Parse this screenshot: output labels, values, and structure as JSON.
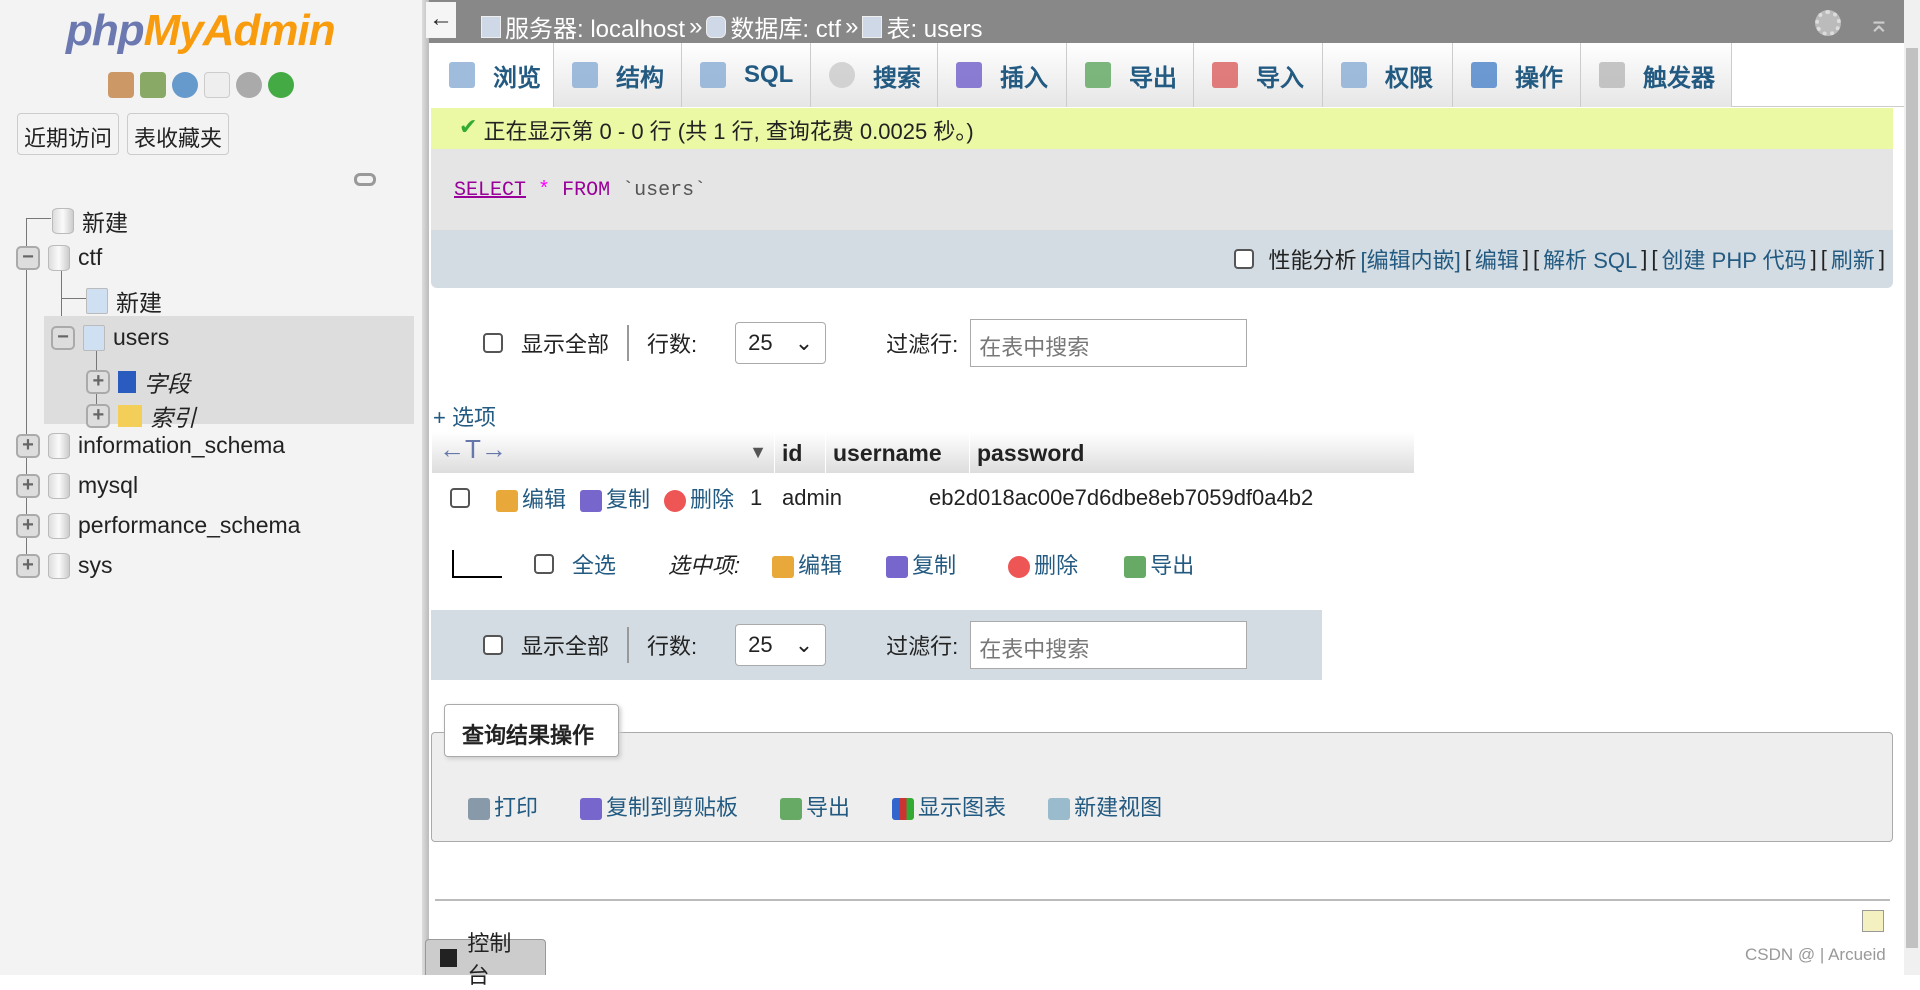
{
  "sidebar": {
    "logo_php": "php",
    "logo_my": "MyAdmin",
    "recent": "近期访问",
    "favorites": "表收藏夹",
    "tree": [
      {
        "label": "新建"
      },
      {
        "label": "ctf"
      },
      {
        "label": "新建"
      },
      {
        "label": "users"
      },
      {
        "label": "字段"
      },
      {
        "label": "索引"
      },
      {
        "label": "information_schema"
      },
      {
        "label": "mysql"
      },
      {
        "label": "performance_schema"
      },
      {
        "label": "sys"
      }
    ]
  },
  "breadcrumb": {
    "server": "服务器: localhost",
    "sep": "»",
    "database": "数据库: ctf",
    "table": "表: users"
  },
  "tabs": [
    {
      "label": "浏览"
    },
    {
      "label": "结构"
    },
    {
      "label": "SQL"
    },
    {
      "label": "搜索"
    },
    {
      "label": "插入"
    },
    {
      "label": "导出"
    },
    {
      "label": "导入"
    },
    {
      "label": "权限"
    },
    {
      "label": "操作"
    },
    {
      "label": "触发器"
    }
  ],
  "success": "正在显示第 0 - 0 行 (共 1 行, 查询花费 0.0025 秒。)",
  "sql": {
    "select": "SELECT",
    "star": "*",
    "from": "FROM",
    "table": "`users`"
  },
  "options": {
    "profiling": "性能分析",
    "inline_edit": "[编辑内嵌]",
    "edit": "编辑",
    "explain": "解析 SQL",
    "php": "创建 PHP 代码",
    "refresh": "刷新"
  },
  "nav": {
    "show_all": "显示全部",
    "rows_label": "行数:",
    "rows_value": "25",
    "filter_label": "过滤行:",
    "filter_placeholder": "在表中搜索"
  },
  "more_options": "+ 选项",
  "table": {
    "columns": [
      "id",
      "username",
      "password"
    ],
    "rows": [
      {
        "id": "1",
        "username": "admin",
        "password": "eb2d018ac00e7d6dbe8eb7059df0a4b2"
      }
    ],
    "edit": "编辑",
    "copy": "复制",
    "delete": "删除"
  },
  "bulk": {
    "check_all": "全选",
    "with_selected": "选中项:",
    "edit": "编辑",
    "copy": "复制",
    "delete": "删除",
    "export": "导出"
  },
  "query_ops": {
    "legend": "查询结果操作",
    "print": "打印",
    "copy_clipboard": "复制到剪贴板",
    "export": "导出",
    "chart": "显示图表",
    "create_view": "新建视图"
  },
  "console": "控制台",
  "watermark": "CSDN @ | Arcueid"
}
